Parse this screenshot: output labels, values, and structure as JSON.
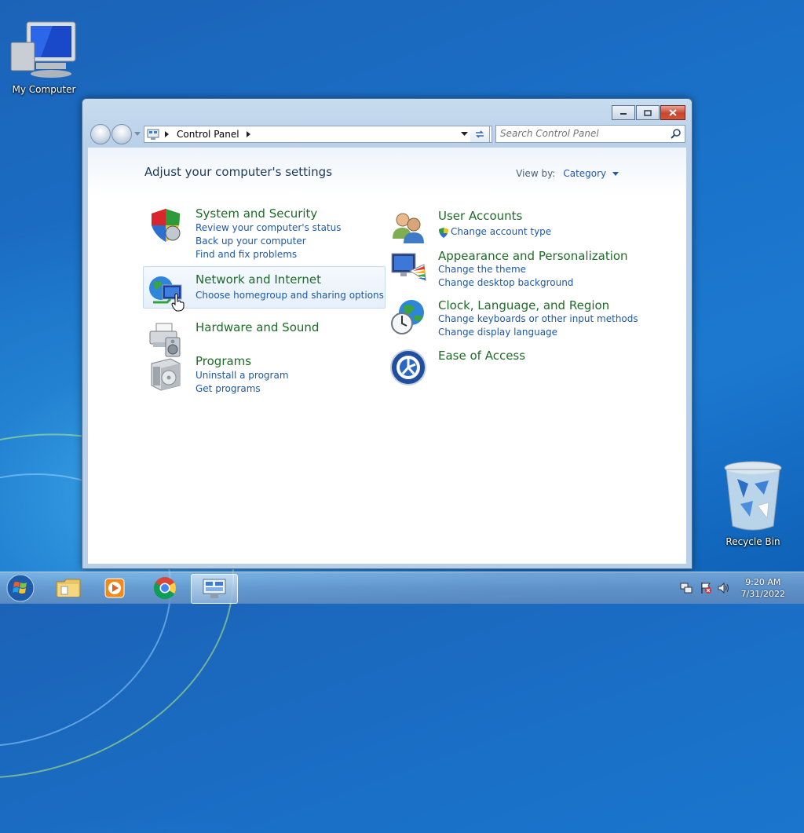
{
  "desktop": {
    "icons": [
      {
        "label": "My Computer"
      },
      {
        "label": "Recycle Bin"
      }
    ]
  },
  "window": {
    "address": {
      "crumb": "Control Panel"
    },
    "search": {
      "placeholder": "Search Control Panel"
    },
    "heading": "Adjust your computer's settings",
    "view_by": {
      "label": "View by:",
      "value": "Category"
    },
    "categories": [
      {
        "title": "System and Security",
        "links": [
          "Review your computer's status",
          "Back up your computer",
          "Find and fix problems"
        ]
      },
      {
        "title": "Network and Internet",
        "links": [
          "Choose homegroup and sharing options"
        ]
      },
      {
        "title": "Hardware and Sound",
        "links": []
      },
      {
        "title": "Programs",
        "links": [
          "Uninstall a program",
          "Get programs"
        ]
      },
      {
        "title": "User Accounts",
        "links": [
          "Change account type"
        ]
      },
      {
        "title": "Appearance and Personalization",
        "links": [
          "Change the theme",
          "Change desktop background"
        ]
      },
      {
        "title": "Clock, Language, and Region",
        "links": [
          "Change keyboards or other input methods",
          "Change display language"
        ]
      },
      {
        "title": "Ease of Access",
        "links": []
      }
    ]
  },
  "taskbar": {
    "items": [
      {
        "icon": "start-orb-icon"
      },
      {
        "icon": "windows-explorer-icon"
      },
      {
        "icon": "media-player-icon"
      },
      {
        "icon": "chrome-icon"
      },
      {
        "icon": "control-panel-icon",
        "active": true
      }
    ],
    "clock": {
      "time": "9:20 AM",
      "date": "7/31/2022"
    }
  }
}
